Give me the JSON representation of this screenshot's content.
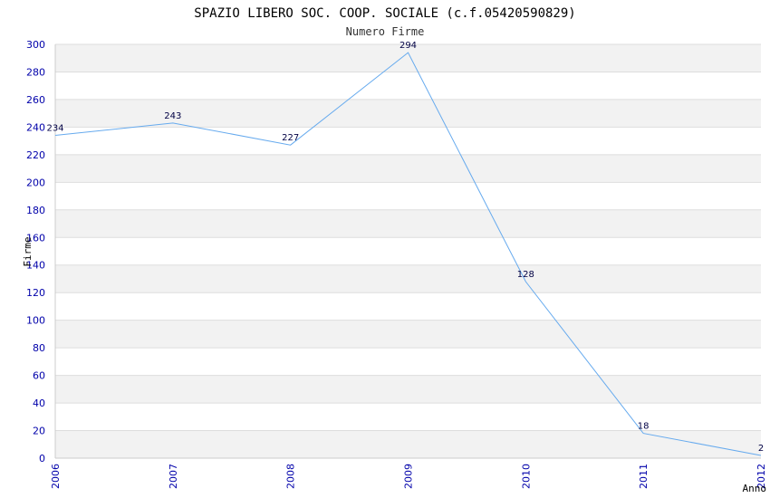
{
  "chart_data": {
    "type": "line",
    "title": "SPAZIO LIBERO SOC. COOP. SOCIALE (c.f.05420590829)",
    "subtitle": "Numero Firme",
    "xlabel": "Anno",
    "ylabel": "Firme",
    "x": [
      "2006",
      "2007",
      "2008",
      "2009",
      "2010",
      "2011",
      "2012"
    ],
    "series": [
      {
        "values": [
          234,
          243,
          227,
          294,
          128,
          18,
          2
        ]
      }
    ],
    "ylim": [
      0,
      300
    ],
    "yticks": [
      0,
      20,
      40,
      60,
      80,
      100,
      120,
      140,
      160,
      180,
      200,
      220,
      240,
      260,
      280,
      300
    ],
    "grid": true,
    "colors": {
      "line": "#66aaee",
      "band": "#f2f2f2",
      "grid": "#dddddd",
      "tick": "#0000aa",
      "data_label": "#000044"
    }
  }
}
